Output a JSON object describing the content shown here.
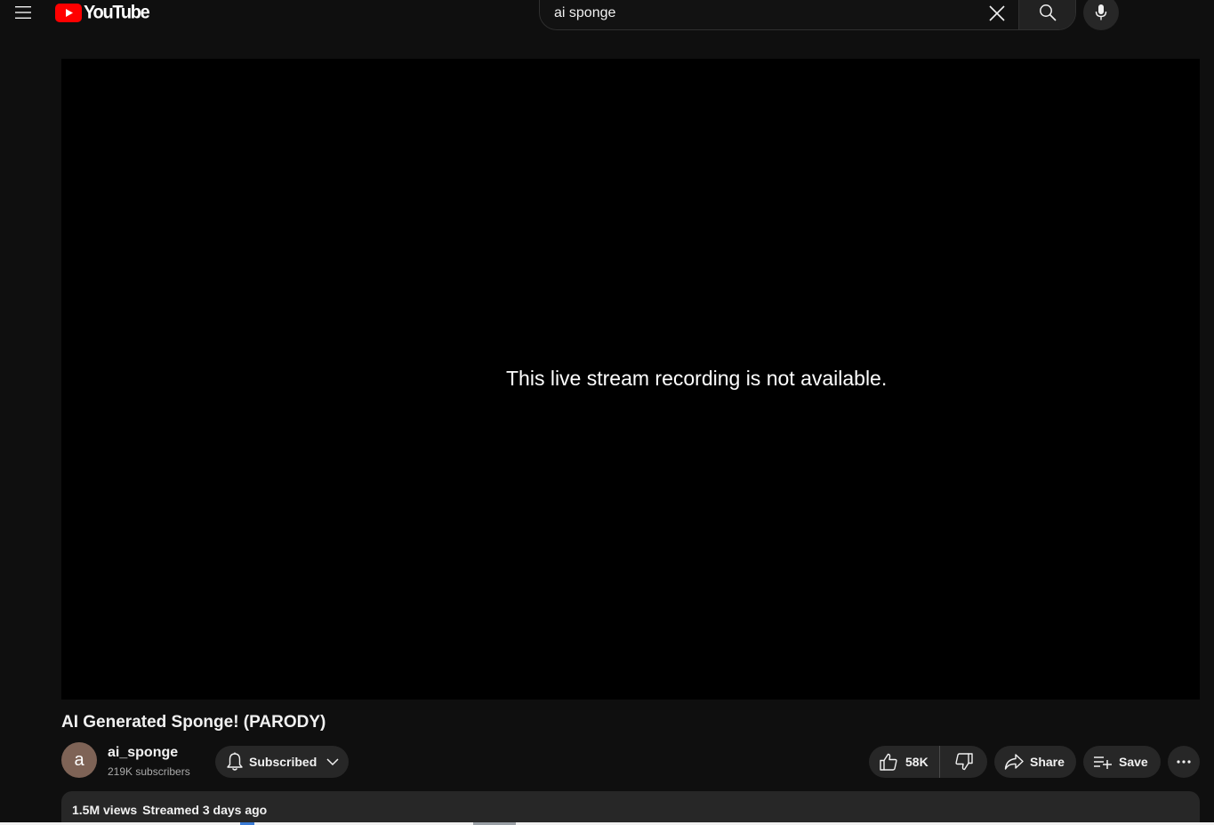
{
  "masthead": {
    "logo_text": "YouTube",
    "search": {
      "value": "ai sponge",
      "placeholder": "Search"
    }
  },
  "player": {
    "message": "This live stream recording is not available."
  },
  "video": {
    "title": "AI Generated Sponge! (PARODY)",
    "channel": {
      "avatar_letter": "a",
      "name": "ai_sponge",
      "subscribers": "219K subscribers",
      "subscribe_label": "Subscribed"
    },
    "actions": {
      "like_count": "58K",
      "share_label": "Share",
      "save_label": "Save"
    },
    "description": {
      "views": "1.5M views",
      "date": "Streamed 3 days ago"
    }
  },
  "colors": {
    "background": "#0f0f0f",
    "brand_red": "#ff0000",
    "button_bg": "#272727"
  },
  "icons": [
    "menu-icon",
    "youtube-logo-icon",
    "close-icon",
    "search-icon",
    "mic-icon",
    "bell-icon",
    "chevron-down-icon",
    "thumbs-up-icon",
    "thumbs-down-icon",
    "share-icon",
    "playlist-add-icon",
    "more-horizontal-icon"
  ]
}
